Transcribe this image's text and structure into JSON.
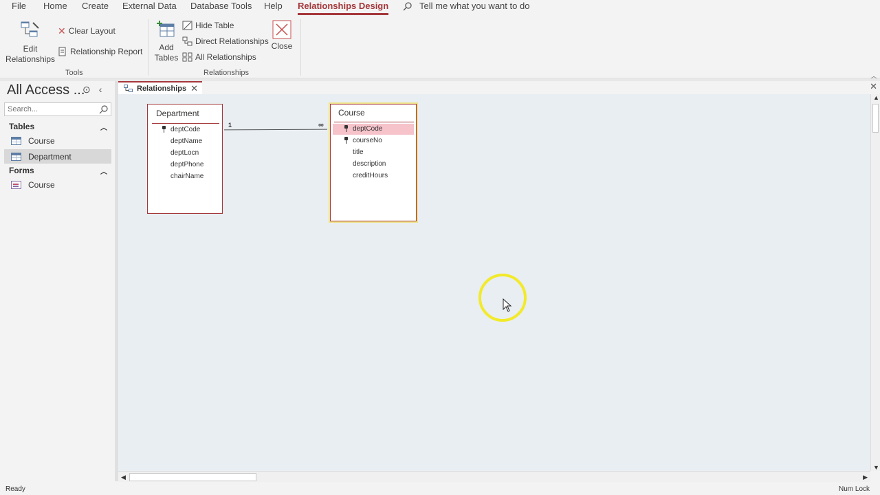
{
  "menu": {
    "tabs": [
      "File",
      "Home",
      "Create",
      "External Data",
      "Database Tools",
      "Help",
      "Relationships Design"
    ],
    "active_tab": "Relationships Design",
    "tell_me": "Tell me what you want to do"
  },
  "ribbon": {
    "tools": {
      "edit_relationships": "Edit\nRelationships",
      "clear_layout": "Clear Layout",
      "relationship_report": "Relationship Report",
      "group_label": "Tools"
    },
    "relationships": {
      "add_tables": "Add\nTables",
      "hide_table": "Hide Table",
      "direct_relationships": "Direct Relationships",
      "all_relationships": "All Relationships",
      "close": "Close",
      "group_label": "Relationships"
    }
  },
  "nav": {
    "title": "All Access ...",
    "search_placeholder": "Search...",
    "sections": [
      {
        "label": "Tables",
        "items": [
          "Course",
          "Department"
        ]
      },
      {
        "label": "Forms",
        "items": [
          "Course"
        ]
      }
    ],
    "selected_item": "Department"
  },
  "document": {
    "tab_label": "Relationships"
  },
  "diagram": {
    "tables": [
      {
        "name": "Department",
        "fields": [
          "deptCode",
          "deptName",
          "deptLocn",
          "deptPhone",
          "chairName"
        ],
        "key_fields": [
          "deptCode"
        ]
      },
      {
        "name": "Course",
        "fields": [
          "deptCode",
          "courseNo",
          "title",
          "description",
          "creditHours"
        ],
        "key_fields": [
          "deptCode",
          "courseNo"
        ],
        "highlighted_field": "deptCode"
      }
    ],
    "relationship": {
      "from": "Department.deptCode",
      "to": "Course.deptCode",
      "one_label": "1",
      "many_label": "∞"
    }
  },
  "status": {
    "left": "Ready",
    "right": "Num Lock"
  },
  "colors": {
    "accent": "#a4373a",
    "canvas": "#e9eef2",
    "highlight": "#f6c3cb",
    "cursor_ring": "#f2ea2a"
  }
}
